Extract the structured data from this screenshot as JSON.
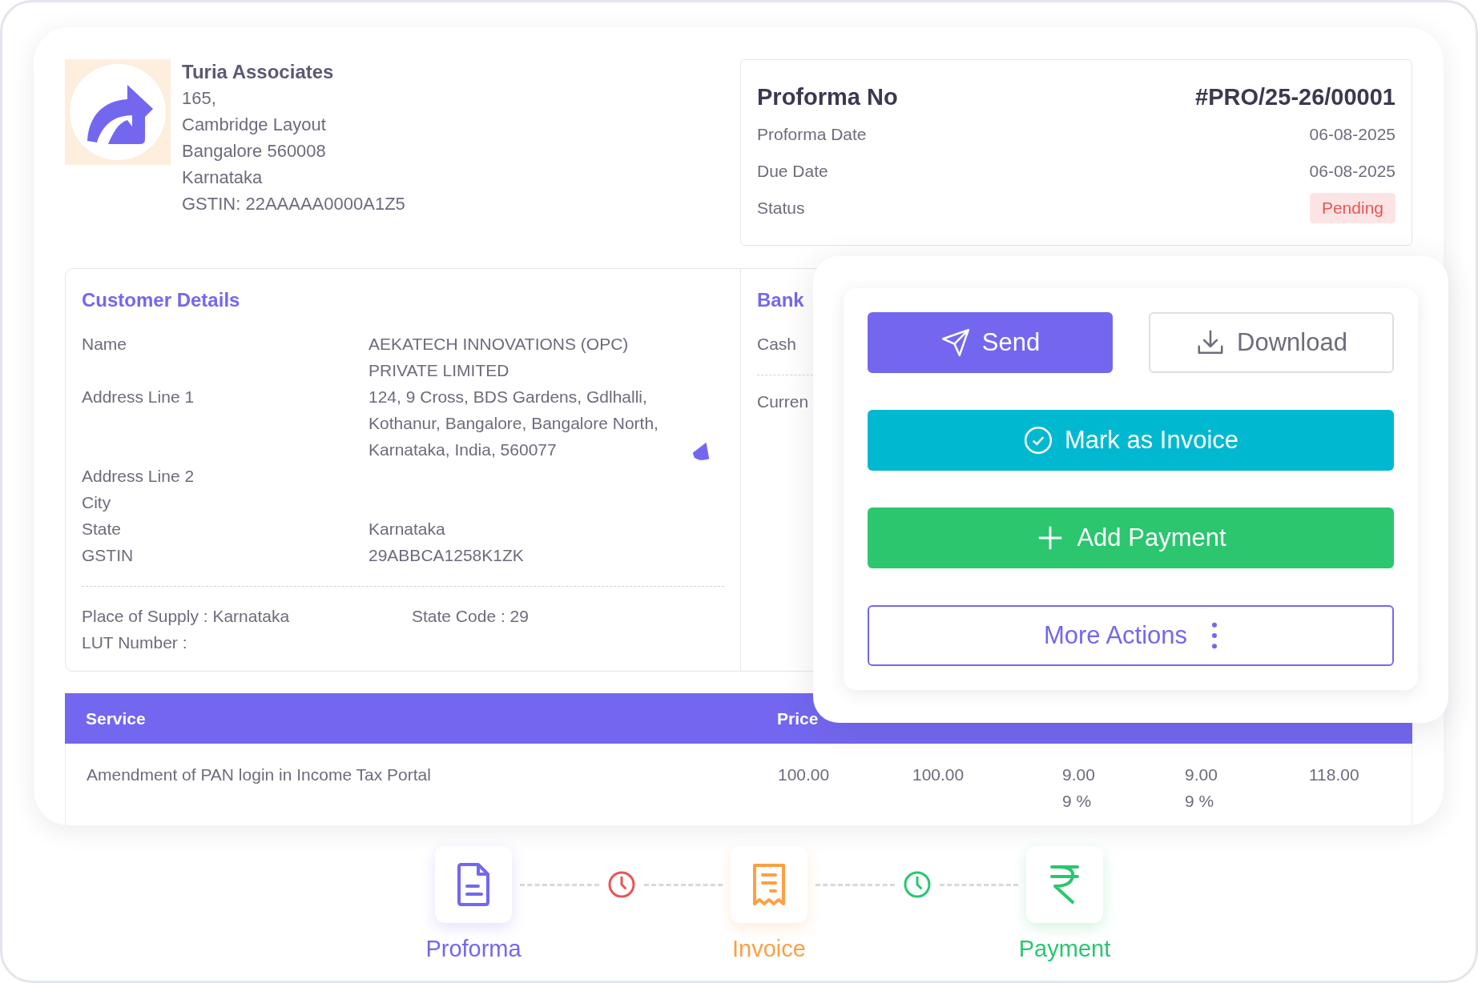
{
  "company": {
    "name": "Turia Associates",
    "lines": [
      "165,",
      "Cambridge Layout",
      "Bangalore 560008",
      "Karnataka",
      "GSTIN: 22AAAAA0000A1Z5"
    ]
  },
  "proforma": {
    "title": "Proforma No",
    "number": "#PRO/25-26/00001",
    "fields": [
      {
        "label": "Proforma Date",
        "value": "06-08-2025",
        "kind": "text"
      },
      {
        "label": "Due Date",
        "value": "06-08-2025",
        "kind": "text"
      },
      {
        "label": "Status",
        "value": "Pending",
        "kind": "badge"
      }
    ]
  },
  "customer": {
    "title": "Customer Details",
    "fields": [
      {
        "label": "Name",
        "value": "AEKATECH INNOVATIONS (OPC) PRIVATE LIMITED"
      },
      {
        "label": "Address Line 1",
        "value": "124, 9 Cross, BDS Gardens, Gdlhalli, Kothanur, Bangalore, Bangalore North, Karnataka, India, 560077"
      },
      {
        "label": "Address Line 2"
      },
      {
        "label": "City"
      },
      {
        "label": "State",
        "value": "Karnataka"
      },
      {
        "label": "GSTIN",
        "value": "29ABBCA1258K1ZK"
      }
    ],
    "place_of_supply": "Place of Supply : Karnataka",
    "state_code": "State Code : 29",
    "lut": "LUT Number :"
  },
  "bank": {
    "title": "Bank",
    "items": [
      "Cash",
      "Curren"
    ]
  },
  "actions": [
    {
      "label": "Send",
      "kind": "send"
    },
    {
      "label": "Download",
      "kind": "download"
    },
    {
      "label": "Mark as Invoice",
      "kind": "invoice"
    },
    {
      "label": "Add Payment",
      "kind": "payment"
    },
    {
      "label": "More Actions",
      "kind": "more"
    }
  ],
  "table": {
    "columns": [
      "Service",
      "Price"
    ],
    "rows": [
      {
        "service": "Amendment of PAN login in Income Tax Portal",
        "price": "100.00",
        "amount": "100.00",
        "sgst": "9.00",
        "sgst_rate": "9 %",
        "cgst": "9.00",
        "cgst_rate": "9 %",
        "total": "118.00"
      }
    ]
  },
  "flow": {
    "steps": [
      {
        "label": "Proforma",
        "kind": "proforma",
        "color": "#7367f0"
      },
      {
        "label": "Invoice",
        "kind": "invoice",
        "color": "#ff9f43"
      },
      {
        "label": "Payment",
        "kind": "payment",
        "color": "#28c76f"
      }
    ],
    "connectors": [
      {
        "color": "#ea5455"
      },
      {
        "color": "#28c76f"
      }
    ]
  }
}
